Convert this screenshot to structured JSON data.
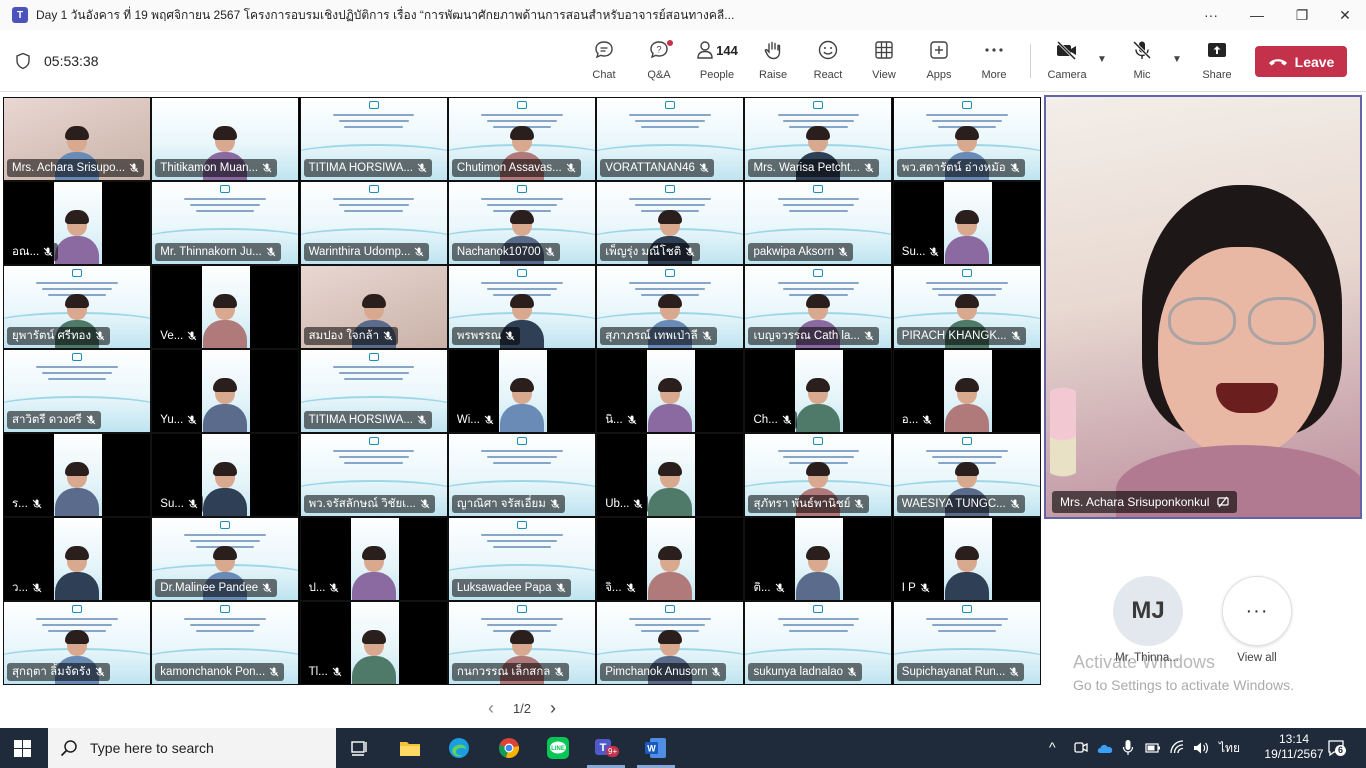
{
  "window": {
    "title": "Day 1 วันอังคาร ที่ 19 พฤศจิกายน 2567 โครงการอบรมเชิงปฏิบัติการ เรื่อง “การพัฒนาศักยภาพด้านการสอนสำหรับอาจารย์สอนทางคลี...",
    "more": "···",
    "minimize": "—",
    "maximize": "❐",
    "close": "✕"
  },
  "toolbar": {
    "timer": "05:53:38",
    "chat": "Chat",
    "qa": "Q&A",
    "people": "People",
    "people_count": "144",
    "raise": "Raise",
    "react": "React",
    "view": "View",
    "apps": "Apps",
    "more": "More",
    "camera": "Camera",
    "mic": "Mic",
    "share": "Share",
    "leave": "Leave"
  },
  "grid": {
    "tiles": [
      {
        "name": "Mrs. Achara Srisupo...",
        "kind": "photo"
      },
      {
        "name": "Thitikamon Muan...",
        "kind": "person"
      },
      {
        "name": "TITIMA HORSIWA...",
        "kind": "slide"
      },
      {
        "name": "Chutimon Assavas...",
        "kind": "slide-person"
      },
      {
        "name": "VORATTANAN46",
        "kind": "slide"
      },
      {
        "name": "Mrs. Warisa Petcht...",
        "kind": "slide-person"
      },
      {
        "name": "พว.สดารัตน์ อ่างหมัอ",
        "kind": "slide-person"
      },
      {
        "name": "อณ...",
        "kind": "narrow"
      },
      {
        "name": "Mr. Thinnakorn Ju...",
        "kind": "slide"
      },
      {
        "name": "Warinthira Udomp...",
        "kind": "slide"
      },
      {
        "name": "Nachanok10700",
        "kind": "slide-person"
      },
      {
        "name": "เพ็ญรุ่ง มณีโชติ",
        "kind": "slide-person"
      },
      {
        "name": "pakwipa Aksorn",
        "kind": "slide"
      },
      {
        "name": "Su...",
        "kind": "narrow"
      },
      {
        "name": "ยุพารัตน์ ศรีทอง",
        "kind": "slide-person"
      },
      {
        "name": "Ve...",
        "kind": "narrow"
      },
      {
        "name": "สมปอง ใจกล้า",
        "kind": "photo-person"
      },
      {
        "name": "พรพรรณ",
        "kind": "slide-person"
      },
      {
        "name": "สุภาภรณ์ เทพเป่าลี",
        "kind": "slide-person"
      },
      {
        "name": "เบญจวรรณ Cath la...",
        "kind": "slide-person"
      },
      {
        "name": "PIRACH KHANGK...",
        "kind": "slide-person"
      },
      {
        "name": "สาวิตรี ดวงศรี",
        "kind": "slide"
      },
      {
        "name": "Yu...",
        "kind": "narrow"
      },
      {
        "name": "TITIMA HORSIWA...",
        "kind": "slide"
      },
      {
        "name": "Wi...",
        "kind": "narrow"
      },
      {
        "name": "นิ...",
        "kind": "narrow"
      },
      {
        "name": "Ch...",
        "kind": "narrow"
      },
      {
        "name": "อ...",
        "kind": "narrow"
      },
      {
        "name": "ร...",
        "kind": "narrow"
      },
      {
        "name": "Su...",
        "kind": "narrow"
      },
      {
        "name": "พว.จรัสลักษณ์ วิชัยเ...",
        "kind": "slide"
      },
      {
        "name": "ญาณิศา จรัสเอี่ยม",
        "kind": "slide"
      },
      {
        "name": "Ub...",
        "kind": "narrow"
      },
      {
        "name": "สุภัทรา พันธ์พานิชย์",
        "kind": "slide-person"
      },
      {
        "name": "WAESIYA TUNGC...",
        "kind": "slide-person"
      },
      {
        "name": "ว...",
        "kind": "narrow"
      },
      {
        "name": "Dr.Malinee Pandee",
        "kind": "slide-person"
      },
      {
        "name": "ป...",
        "kind": "narrow"
      },
      {
        "name": "Luksawadee Papa",
        "kind": "slide"
      },
      {
        "name": "จิ...",
        "kind": "narrow"
      },
      {
        "name": "ติ...",
        "kind": "narrow"
      },
      {
        "name": "I P",
        "kind": "narrow"
      },
      {
        "name": "สุกฤตา ลิ้มจัดรัง",
        "kind": "slide-person"
      },
      {
        "name": "kamonchanok Pon...",
        "kind": "slide"
      },
      {
        "name": "Tl...",
        "kind": "narrow"
      },
      {
        "name": "กนกวรรณ เล็กสกล",
        "kind": "slide-person"
      },
      {
        "name": "Pimchanok Anusorn",
        "kind": "slide-person"
      },
      {
        "name": "sukunya ladnalao",
        "kind": "slide"
      },
      {
        "name": "Supichayanat Run...",
        "kind": "slide"
      }
    ]
  },
  "spotlight": {
    "name": "Mrs. Achara Srisuponkonkul"
  },
  "side": {
    "mj_initials": "MJ",
    "mj_name": "Mr. Thinna...",
    "view_all_icon": "···",
    "view_all": "View all"
  },
  "watermark": {
    "line1": "Activate Windows",
    "line2": "Go to Settings to activate Windows."
  },
  "pager": {
    "prev": "‹",
    "label": "1/2",
    "next": "›"
  },
  "taskbar": {
    "search_placeholder": "Type here to search",
    "lang": "ไทย",
    "time": "13:14",
    "date": "19/11/2567",
    "notification_count": "6",
    "teams_badge": "9+"
  },
  "colors": {
    "leave": "#c4314b",
    "accent": "#6264a7",
    "taskbar": "#1f2b3a"
  }
}
